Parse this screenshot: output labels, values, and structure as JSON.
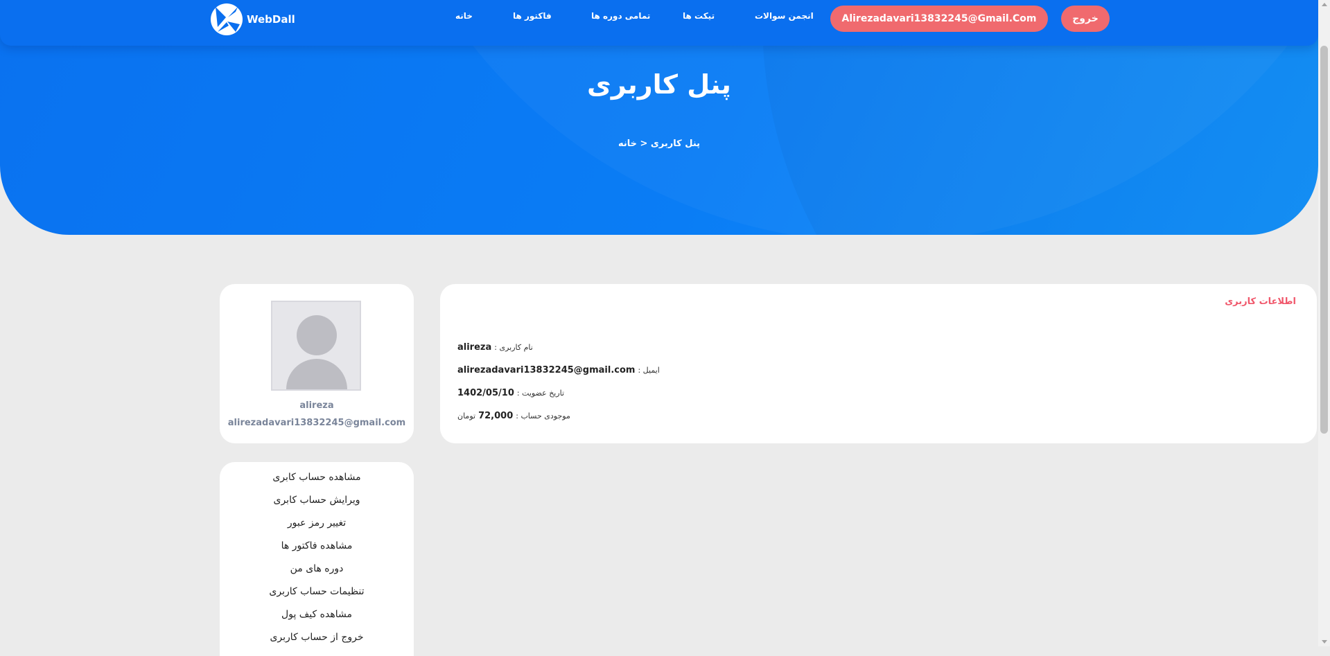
{
  "header": {
    "brand": "WebDall",
    "nav": [
      "خانه",
      "فاکتور ها",
      "تمامی دوره ها",
      "تیکت ها",
      "انجمن سوالات"
    ],
    "user_button": "Alirezadavari13832245@Gmail.Com",
    "logout_button": "خروج"
  },
  "hero": {
    "title": "پنل کاربری",
    "breadcrumb": "پنل کاربری < خانه"
  },
  "profile": {
    "name": "alireza",
    "email": "alirezadavari13832245@gmail.com"
  },
  "info": {
    "heading": "اطلاعات کاربری",
    "rows": [
      {
        "label": "نام کاربری :",
        "value": "alireza",
        "suffix": ""
      },
      {
        "label": "ایمیل :",
        "value": "alirezadavari13832245@gmail.com",
        "suffix": ""
      },
      {
        "label": "تاریخ عضویت :",
        "value": "1402/05/10",
        "suffix": ""
      },
      {
        "label": "موجودی حساب :",
        "value": "72,000",
        "suffix": "تومان"
      }
    ]
  },
  "menu": [
    "مشاهده حساب کابری",
    "ویرایش حساب کابری",
    "تغییر رمز عبور",
    "مشاهده فاکتور ها",
    "دوره های من",
    "تنظیمات حساب کاربری",
    "مشاهده کیف پول",
    "خروج از حساب کاربری"
  ],
  "colors": {
    "primary": "#0a72f0",
    "accent": "#f06a6e",
    "background": "#ebebeb"
  },
  "icons": [
    "webdall-logo-icon",
    "user-avatar-icon"
  ]
}
